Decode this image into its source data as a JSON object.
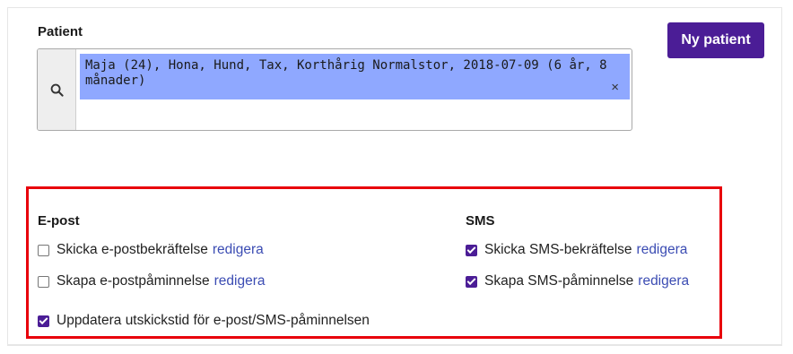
{
  "patient": {
    "label": "Patient",
    "selected_text": "Maja (24), Hona, Hund, Tax, Korthårig Normalstor, 2018-07-09 (6 år, 8 månader)",
    "remove_symbol": "×"
  },
  "toolbar": {
    "new_patient_label": "Ny patient"
  },
  "notifications": {
    "email": {
      "heading": "E-post",
      "options": [
        {
          "label": "Skicka e-postbekräftelse",
          "link": "redigera",
          "checked": false
        },
        {
          "label": "Skapa e-postpåminnelse",
          "link": "redigera",
          "checked": false
        }
      ]
    },
    "sms": {
      "heading": "SMS",
      "options": [
        {
          "label": "Skicka SMS-bekräftelse",
          "link": "redigera",
          "checked": true
        },
        {
          "label": "Skapa SMS-påminnelse",
          "link": "redigera",
          "checked": true
        }
      ]
    },
    "update_time": {
      "label": "Uppdatera utskickstid för e-post/SMS-påminnelsen",
      "checked": true
    }
  },
  "colors": {
    "accent": "#4b1d96",
    "chip": "#8fa8ff",
    "highlight_border": "#e8000b",
    "link": "#3b4cb3"
  },
  "icons": {
    "search": "search-icon"
  }
}
